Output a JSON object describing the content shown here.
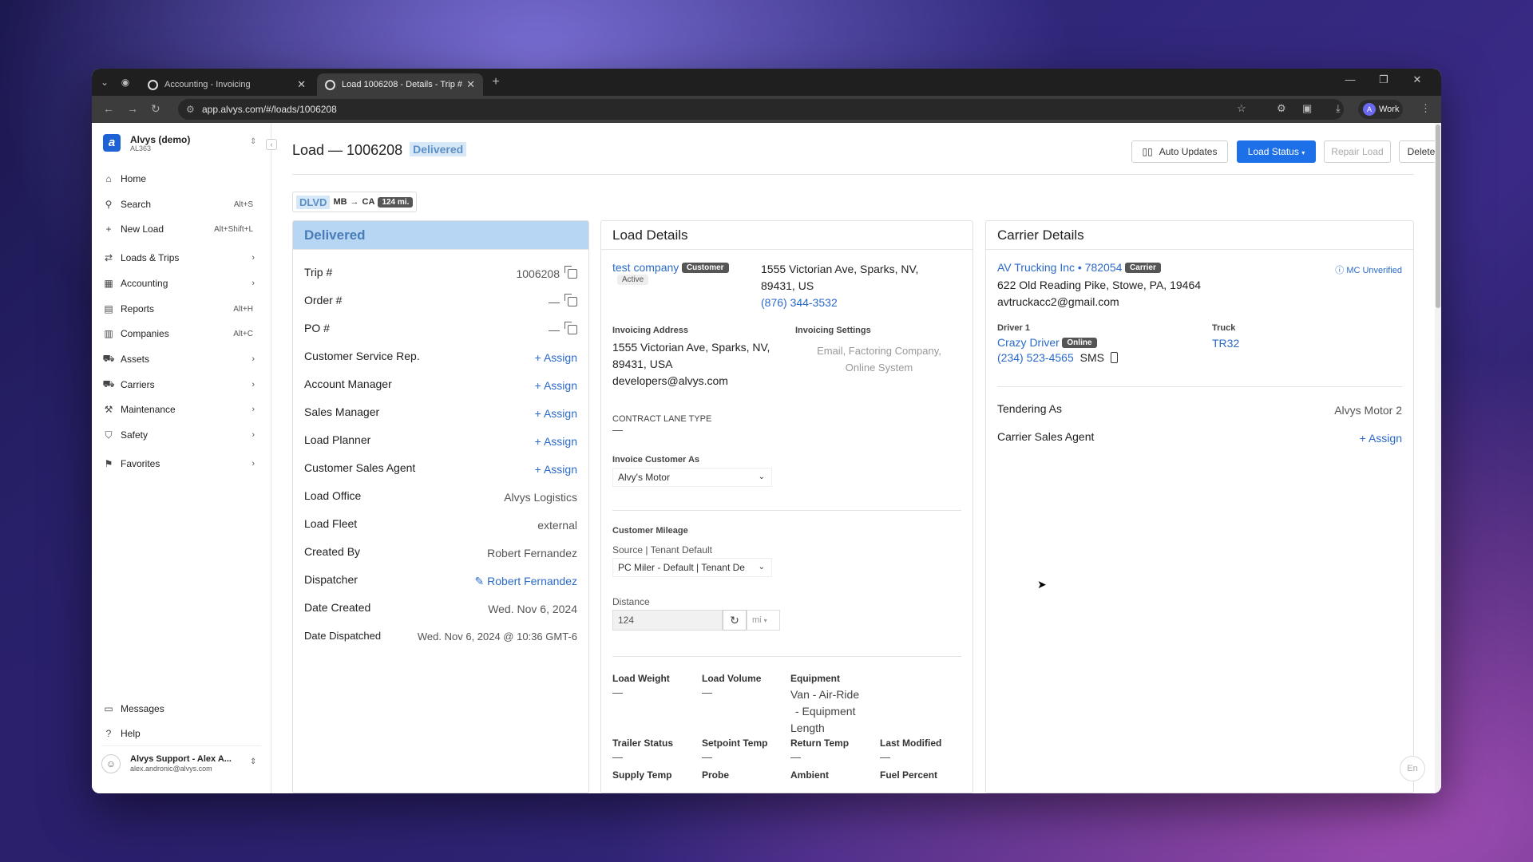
{
  "browser": {
    "tabs": [
      {
        "title": "Accounting - Invoicing"
      },
      {
        "title": "Load 1006208 - Details - Trip #"
      }
    ],
    "url": "app.alvys.com/#/loads/1006208",
    "profile": "Work"
  },
  "sidebar": {
    "org_name": "Alvys (demo)",
    "org_code": "AL363",
    "items": [
      {
        "label": "Home",
        "icon": "home-icon",
        "shortcut": ""
      },
      {
        "label": "Search",
        "icon": "search-icon",
        "shortcut": "Alt+S"
      },
      {
        "label": "New Load",
        "icon": "plus-icon",
        "shortcut": "Alt+Shift+L"
      },
      {
        "label": "Loads & Trips",
        "icon": "route-icon",
        "shortcut": ""
      },
      {
        "label": "Accounting",
        "icon": "accounting-icon",
        "shortcut": ""
      },
      {
        "label": "Reports",
        "icon": "reports-icon",
        "shortcut": "Alt+H"
      },
      {
        "label": "Companies",
        "icon": "building-icon",
        "shortcut": "Alt+C"
      },
      {
        "label": "Assets",
        "icon": "assets-icon",
        "shortcut": ""
      },
      {
        "label": "Carriers",
        "icon": "truck-icon",
        "shortcut": ""
      },
      {
        "label": "Maintenance",
        "icon": "wrench-icon",
        "shortcut": ""
      },
      {
        "label": "Safety",
        "icon": "shield-icon",
        "shortcut": ""
      },
      {
        "label": "Favorites",
        "icon": "bookmark-icon",
        "shortcut": ""
      }
    ],
    "bottom": [
      {
        "label": "Messages",
        "icon": "message-icon"
      },
      {
        "label": "Help",
        "icon": "help-icon"
      }
    ],
    "user_name": "Alvys Support - Alex A...",
    "user_email": "alex.andronic@alvys.com"
  },
  "header": {
    "title": "Load — 1006208",
    "status": "Delivered",
    "buttons": {
      "auto_updates": "Auto Updates",
      "load_status": "Load Status",
      "repair_load": "Repair Load",
      "delete_load": "Delete Load"
    }
  },
  "route": {
    "status": "DLVD",
    "from": "MB",
    "to": "CA",
    "miles": "124 mi."
  },
  "left_panel": {
    "title": "Delivered",
    "assign_label": "Assign",
    "rows": [
      {
        "label": "Trip #",
        "value": "1006208"
      },
      {
        "label": "Order #",
        "value": "—"
      },
      {
        "label": "PO #",
        "value": "—"
      },
      {
        "label": "Customer Service Rep.",
        "value": ""
      },
      {
        "label": "Account Manager",
        "value": ""
      },
      {
        "label": "Sales Manager",
        "value": ""
      },
      {
        "label": "Load Planner",
        "value": ""
      },
      {
        "label": "Customer Sales Agent",
        "value": ""
      },
      {
        "label": "Load Office",
        "value": "Alvys Logistics"
      },
      {
        "label": "Load Fleet",
        "value": "external"
      },
      {
        "label": "Created By",
        "value": "Robert Fernandez"
      },
      {
        "label": "Dispatcher",
        "value": "Robert Fernandez"
      },
      {
        "label": "Date Created",
        "value": "Wed. Nov 6, 2024"
      },
      {
        "label": "Date Dispatched",
        "value": "Wed. Nov 6, 2024 @ 10:36 GMT-6"
      }
    ]
  },
  "load_details": {
    "title": "Load Details",
    "customer_name": "test company",
    "customer_tag": "Customer",
    "customer_status": "Active",
    "address_line1": "1555 Victorian Ave, Sparks, NV,",
    "address_line2": "89431, US",
    "phone": "(876) 344-3532",
    "invoicing_address_label": "Invoicing Address",
    "invoicing_address_line1": "1555 Victorian Ave, Sparks, NV,",
    "invoicing_address_line2": "89431, USA",
    "invoicing_email": "developers@alvys.com",
    "invoicing_settings_label": "Invoicing Settings",
    "invoicing_settings_line1": "Email, Factoring Company,",
    "invoicing_settings_line2": "Online System",
    "contract_lane_label": "CONTRACT LANE TYPE",
    "contract_lane_value": "—",
    "invoice_customer_label": "Invoice Customer As",
    "invoice_customer_value": "Alvy's Motor",
    "mileage_label": "Customer Mileage",
    "mileage_source": "Source | Tenant Default",
    "mileage_select": "PC Miler - Default | Tenant De",
    "distance_label": "Distance",
    "distance_value": "124",
    "distance_unit": "mi",
    "grid": [
      {
        "label": "Load Weight",
        "value": "—"
      },
      {
        "label": "Load Volume",
        "value": "—"
      },
      {
        "label": "Equipment",
        "value": "Van - Air-Ride"
      },
      {
        "label": "Trailer Status",
        "value": "—"
      },
      {
        "label": "Setpoint Temp",
        "value": "—"
      },
      {
        "label": "Return Temp",
        "value": "—"
      },
      {
        "label": "Last Modified",
        "value": "—"
      },
      {
        "label": "Supply Temp",
        "value": ""
      },
      {
        "label": "Probe",
        "value": ""
      },
      {
        "label": "Ambient",
        "value": ""
      },
      {
        "label": "Fuel Percent",
        "value": ""
      }
    ],
    "equipment_extra1": "-  Equipment",
    "equipment_extra2": "Length"
  },
  "carrier_details": {
    "title": "Carrier Details",
    "carrier_name": "AV Trucking Inc • 782054",
    "carrier_tag": "Carrier",
    "mc_status": "MC Unverified",
    "address": "622 Old Reading Pike, Stowe, PA, 19464",
    "email": "avtruckacc2@gmail.com",
    "driver_label": "Driver 1",
    "driver_name": "Crazy Driver",
    "driver_status": "Online",
    "driver_phone": "(234) 523-4565",
    "sms": "SMS",
    "truck_label": "Truck",
    "truck_value": "TR32",
    "tendering_label": "Tendering As",
    "tendering_value": "Alvys Motor 2",
    "sales_agent_label": "Carrier Sales Agent",
    "assign_label": "Assign"
  },
  "lang": "En"
}
